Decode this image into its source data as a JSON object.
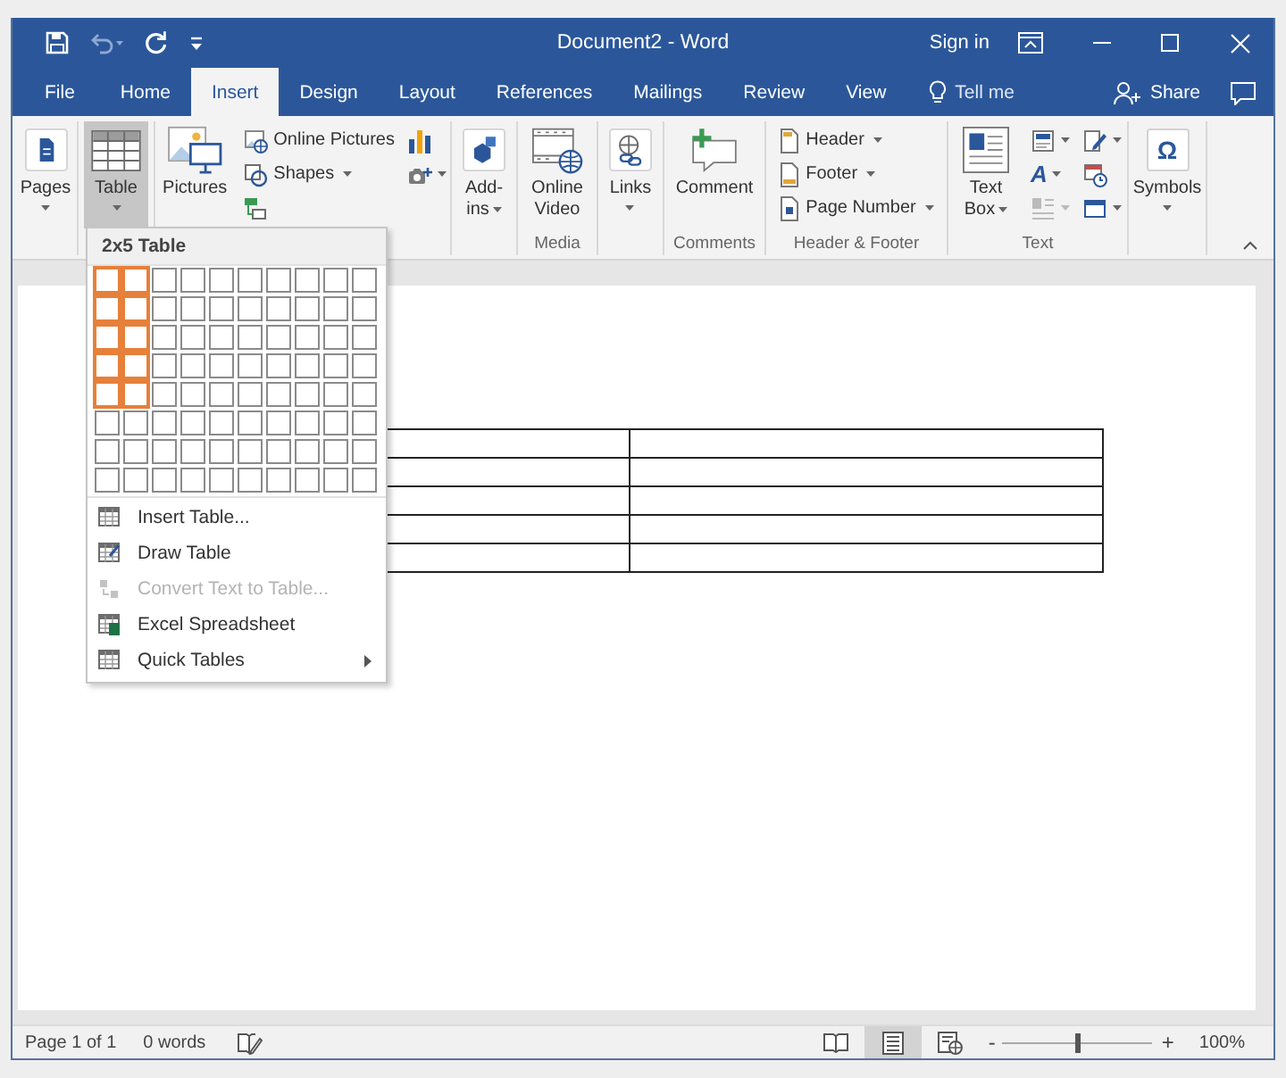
{
  "window": {
    "title": "Document2 - Word",
    "sign_in": "Sign in"
  },
  "quick_access": [
    {
      "disabled": false
    },
    {
      "disabled": true
    },
    {
      "disabled": false
    }
  ],
  "tabs": [
    {
      "label": "File",
      "selected": false
    },
    {
      "label": "Home",
      "selected": false
    },
    {
      "label": "Insert",
      "selected": true
    },
    {
      "label": "Design",
      "selected": false
    },
    {
      "label": "Layout",
      "selected": false
    },
    {
      "label": "References",
      "selected": false
    },
    {
      "label": "Mailings",
      "selected": false
    },
    {
      "label": "Review",
      "selected": false
    },
    {
      "label": "View",
      "selected": false
    }
  ],
  "tell_me": "Tell me",
  "share": "Share",
  "ribbon": [
    {
      "columns": [
        [
          {
            "kind": "large",
            "label": "Pages",
            "menu": true,
            "expanded": false,
            "disabled": false
          }
        ]
      ]
    },
    {
      "columns": [
        [
          {
            "kind": "large",
            "label": "Table",
            "menu": true,
            "expanded": true,
            "disabled": false
          }
        ]
      ]
    },
    {
      "columns": [
        [
          {
            "kind": "large",
            "label": "Pictures",
            "menu": false,
            "expanded": false,
            "disabled": false
          }
        ],
        [
          {
            "kind": "small",
            "label": "Online Pictures",
            "menu": false,
            "expanded": false,
            "disabled": false
          },
          {
            "kind": "small",
            "label": "Shapes",
            "menu": true,
            "expanded": false,
            "disabled": false
          },
          {
            "kind": "icon",
            "menu": false,
            "expanded": false,
            "disabled": false
          }
        ],
        [
          {
            "kind": "icon",
            "menu": false,
            "expanded": false,
            "disabled": false
          },
          {
            "kind": "icon",
            "menu": true,
            "expanded": false,
            "disabled": false
          }
        ]
      ]
    },
    {
      "columns": [
        [
          {
            "kind": "large",
            "label": "Add-ins",
            "menu": true,
            "expanded": false,
            "disabled": false
          }
        ]
      ]
    },
    {
      "label": "Media",
      "columns": [
        [
          {
            "kind": "large",
            "label": "Online Video",
            "menu": false,
            "expanded": false,
            "disabled": false
          }
        ]
      ]
    },
    {
      "columns": [
        [
          {
            "kind": "large",
            "label": "Links",
            "menu": true,
            "expanded": false,
            "disabled": false
          }
        ]
      ]
    },
    {
      "label": "Comments",
      "columns": [
        [
          {
            "kind": "large",
            "label": "Comment",
            "menu": false,
            "expanded": false,
            "disabled": false
          }
        ]
      ]
    },
    {
      "label": "Header & Footer",
      "columns": [
        [
          {
            "kind": "small",
            "label": "Header",
            "menu": true,
            "expanded": false,
            "disabled": false
          },
          {
            "kind": "small",
            "label": "Footer",
            "menu": true,
            "expanded": false,
            "disabled": false
          },
          {
            "kind": "small",
            "label": "Page Number",
            "menu": true,
            "expanded": false,
            "disabled": false
          }
        ]
      ]
    },
    {
      "label": "Text",
      "columns": [
        [
          {
            "kind": "large",
            "label": "Text Box",
            "menu": true,
            "expanded": false,
            "disabled": false
          }
        ],
        [
          {
            "kind": "icon",
            "menu": true,
            "expanded": false,
            "disabled": false
          },
          {
            "kind": "icon",
            "glyph": "A",
            "menu": true,
            "expanded": false,
            "disabled": false
          },
          {
            "kind": "icon",
            "menu": true,
            "expanded": false,
            "disabled": true
          }
        ],
        [
          {
            "kind": "icon",
            "menu": true,
            "expanded": false,
            "disabled": false
          },
          {
            "kind": "icon",
            "menu": false,
            "expanded": false,
            "disabled": false
          },
          {
            "kind": "icon",
            "menu": true,
            "expanded": false,
            "disabled": false
          }
        ]
      ]
    },
    {
      "columns": [
        [
          {
            "kind": "large",
            "label": "Symbols",
            "glyph": "Ω",
            "menu": true,
            "expanded": false,
            "disabled": false
          }
        ]
      ]
    }
  ],
  "table_menu": {
    "title": "2x5 Table",
    "grid": [
      {
        "cells": [
          {
            "selected": true
          },
          {
            "selected": true
          },
          {
            "selected": false
          },
          {
            "selected": false
          },
          {
            "selected": false
          },
          {
            "selected": false
          },
          {
            "selected": false
          },
          {
            "selected": false
          },
          {
            "selected": false
          },
          {
            "selected": false
          }
        ]
      },
      {
        "cells": [
          {
            "selected": true
          },
          {
            "selected": true
          },
          {
            "selected": false
          },
          {
            "selected": false
          },
          {
            "selected": false
          },
          {
            "selected": false
          },
          {
            "selected": false
          },
          {
            "selected": false
          },
          {
            "selected": false
          },
          {
            "selected": false
          }
        ]
      },
      {
        "cells": [
          {
            "selected": true
          },
          {
            "selected": true
          },
          {
            "selected": false
          },
          {
            "selected": false
          },
          {
            "selected": false
          },
          {
            "selected": false
          },
          {
            "selected": false
          },
          {
            "selected": false
          },
          {
            "selected": false
          },
          {
            "selected": false
          }
        ]
      },
      {
        "cells": [
          {
            "selected": true
          },
          {
            "selected": true
          },
          {
            "selected": false
          },
          {
            "selected": false
          },
          {
            "selected": false
          },
          {
            "selected": false
          },
          {
            "selected": false
          },
          {
            "selected": false
          },
          {
            "selected": false
          },
          {
            "selected": false
          }
        ]
      },
      {
        "cells": [
          {
            "selected": true
          },
          {
            "selected": true
          },
          {
            "selected": false
          },
          {
            "selected": false
          },
          {
            "selected": false
          },
          {
            "selected": false
          },
          {
            "selected": false
          },
          {
            "selected": false
          },
          {
            "selected": false
          },
          {
            "selected": false
          }
        ]
      },
      {
        "cells": [
          {
            "selected": false
          },
          {
            "selected": false
          },
          {
            "selected": false
          },
          {
            "selected": false
          },
          {
            "selected": false
          },
          {
            "selected": false
          },
          {
            "selected": false
          },
          {
            "selected": false
          },
          {
            "selected": false
          },
          {
            "selected": false
          }
        ]
      },
      {
        "cells": [
          {
            "selected": false
          },
          {
            "selected": false
          },
          {
            "selected": false
          },
          {
            "selected": false
          },
          {
            "selected": false
          },
          {
            "selected": false
          },
          {
            "selected": false
          },
          {
            "selected": false
          },
          {
            "selected": false
          },
          {
            "selected": false
          }
        ]
      },
      {
        "cells": [
          {
            "selected": false
          },
          {
            "selected": false
          },
          {
            "selected": false
          },
          {
            "selected": false
          },
          {
            "selected": false
          },
          {
            "selected": false
          },
          {
            "selected": false
          },
          {
            "selected": false
          },
          {
            "selected": false
          },
          {
            "selected": false
          }
        ]
      }
    ],
    "items": [
      {
        "label": "Insert Table...",
        "disabled": false,
        "submenu": false
      },
      {
        "label": "Draw Table",
        "disabled": false,
        "submenu": false
      },
      {
        "label": "Convert Text to Table...",
        "disabled": true,
        "submenu": false
      },
      {
        "label": "Excel Spreadsheet",
        "disabled": false,
        "submenu": false
      },
      {
        "label": "Quick Tables",
        "disabled": false,
        "submenu": true
      }
    ]
  },
  "status_bar": {
    "page": "Page 1 of 1",
    "words": "0 words",
    "views": [
      {
        "selected": false
      },
      {
        "selected": true
      },
      {
        "selected": false
      }
    ],
    "zoom_out": "-",
    "zoom": {
      "level": 0.5
    },
    "zoom_in": "+",
    "zoom_text": "100%"
  }
}
